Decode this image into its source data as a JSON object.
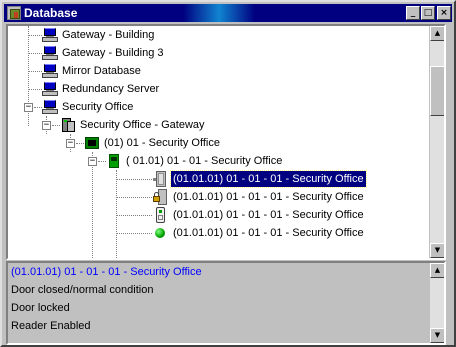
{
  "window": {
    "title": "Database",
    "icon": "database-app-icon"
  },
  "titlebar_buttons": {
    "minimize": "_",
    "maximize": "□",
    "close": "×"
  },
  "tree": {
    "items": [
      {
        "label": "Gateway - Building",
        "icon": "server-icon"
      },
      {
        "label": "Gateway - Building 3",
        "icon": "server-icon"
      },
      {
        "label": "Mirror Database",
        "icon": "server-icon"
      },
      {
        "label": "Redundancy Server",
        "icon": "server-icon"
      },
      {
        "label": "Security Office",
        "icon": "server-icon",
        "expander": "−"
      },
      {
        "label": "Security Office - Gateway",
        "icon": "gateway-icon",
        "expander": "−"
      },
      {
        "label": "(01) 01 - Security Office",
        "icon": "panel-icon",
        "expander": "−"
      },
      {
        "label": "( 01.01) 01 - 01 - Security Office",
        "icon": "board-icon",
        "expander": "−"
      },
      {
        "label": "(01.01.01) 01 - 01 - 01 - Security Office",
        "icon": "door-icon",
        "selected": true
      },
      {
        "label": "(01.01.01) 01 - 01 - 01 - Security Office",
        "icon": "lock-icon"
      },
      {
        "label": "(01.01.01) 01 - 01 - 01 - Security Office",
        "icon": "reader-icon"
      },
      {
        "label": "(01.01.01) 01 - 01 - 01 - Security Office",
        "icon": "status-dot-icon"
      }
    ]
  },
  "info": {
    "lines": [
      "(01.01.01) 01 - 01 - 01 - Security Office",
      "Door closed/normal condition",
      "Door locked",
      "Reader Enabled"
    ]
  },
  "scrollbar_arrows": {
    "up": "▲",
    "down": "▼"
  },
  "colors": {
    "selection": "#000080",
    "info_highlight": "#0000ff",
    "title_bar": "#000080"
  }
}
